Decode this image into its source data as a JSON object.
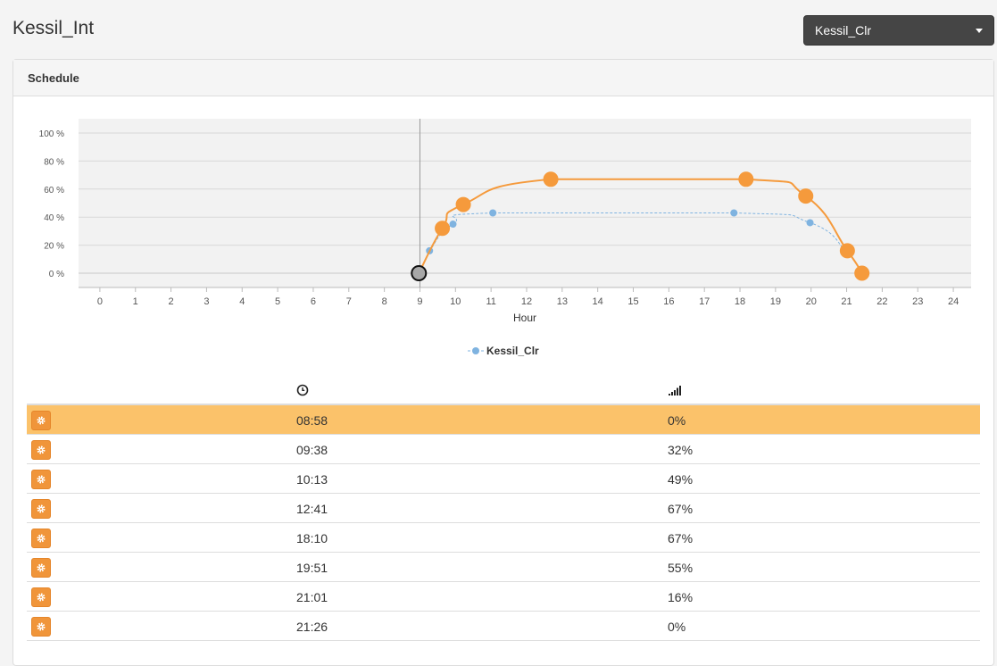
{
  "header": {
    "title": "Kessil_Int",
    "channel_select": {
      "selected": "Kessil_Clr"
    }
  },
  "panel": {
    "title": "Schedule"
  },
  "icons": {
    "dropdown": "caret-down-icon",
    "time_header": "clock-icon",
    "level_header": "signal-bars-icon",
    "row_action": "gear-icon"
  },
  "colors": {
    "accent": "#f59a3c",
    "active_row": "#fbc26a",
    "secondary_series": "#7fb3e0",
    "dropdown_bg": "#454545"
  },
  "chart_data": {
    "type": "line",
    "xlabel": "Hour",
    "ylabel": "",
    "xlim": [
      -0.6,
      24.5
    ],
    "ylim": [
      0,
      100
    ],
    "x_ticks": [
      0,
      1,
      2,
      3,
      4,
      5,
      6,
      7,
      8,
      9,
      10,
      11,
      12,
      13,
      14,
      15,
      16,
      17,
      18,
      19,
      20,
      21,
      22,
      23,
      24
    ],
    "y_ticks": [
      "0 %",
      "20 %",
      "40 %",
      "60 %",
      "80 %",
      "100 %"
    ],
    "y_tick_values": [
      0,
      20,
      40,
      60,
      80,
      100
    ],
    "current_time_marker": 9,
    "series": [
      {
        "name": "",
        "color": "#f59a3c",
        "points": [
          [
            8.97,
            0
          ],
          [
            9.63,
            32
          ],
          [
            10.22,
            49
          ],
          [
            12.68,
            67
          ],
          [
            18.17,
            67
          ],
          [
            19.85,
            55
          ],
          [
            21.02,
            16
          ],
          [
            21.43,
            0
          ]
        ],
        "selected_index": 0
      },
      {
        "name": "Kessil_Clr",
        "color": "#7fb3e0",
        "points": [
          [
            9.27,
            16
          ],
          [
            9.93,
            35
          ],
          [
            11.05,
            43
          ],
          [
            17.83,
            43
          ],
          [
            19.97,
            36
          ],
          [
            21.0,
            15
          ]
        ]
      }
    ],
    "legend": {
      "position": "bottom-center",
      "label": "Kessil_Clr"
    }
  },
  "table": {
    "rows": [
      {
        "time": "08:58",
        "level": "0%",
        "active": true
      },
      {
        "time": "09:38",
        "level": "32%",
        "active": false
      },
      {
        "time": "10:13",
        "level": "49%",
        "active": false
      },
      {
        "time": "12:41",
        "level": "67%",
        "active": false
      },
      {
        "time": "18:10",
        "level": "67%",
        "active": false
      },
      {
        "time": "19:51",
        "level": "55%",
        "active": false
      },
      {
        "time": "21:01",
        "level": "16%",
        "active": false
      },
      {
        "time": "21:26",
        "level": "0%",
        "active": false
      }
    ]
  }
}
